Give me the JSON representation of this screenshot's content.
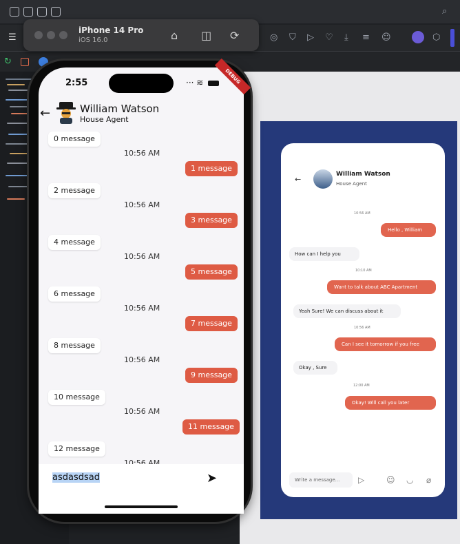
{
  "simulator": {
    "device": "iPhone 14 Pro",
    "os": "iOS 16.0"
  },
  "phone": {
    "time": "2:55",
    "debug_banner": "DEBUG",
    "contact_name": "William Watson",
    "contact_role": "House Agent",
    "messages": [
      {
        "type": "in",
        "text": "0 message"
      },
      {
        "type": "ts",
        "text": "10:56 AM"
      },
      {
        "type": "out",
        "text": "1 message"
      },
      {
        "type": "in",
        "text": "2 message"
      },
      {
        "type": "ts",
        "text": "10:56 AM"
      },
      {
        "type": "out",
        "text": "3 message"
      },
      {
        "type": "in",
        "text": "4 message"
      },
      {
        "type": "ts",
        "text": "10:56 AM"
      },
      {
        "type": "out",
        "text": "5 message"
      },
      {
        "type": "in",
        "text": "6 message"
      },
      {
        "type": "ts",
        "text": "10:56 AM"
      },
      {
        "type": "out",
        "text": "7 message"
      },
      {
        "type": "in",
        "text": "8 message"
      },
      {
        "type": "ts",
        "text": "10:56 AM"
      },
      {
        "type": "out",
        "text": "9 message"
      },
      {
        "type": "in",
        "text": "10 message"
      },
      {
        "type": "ts",
        "text": "10:56 AM"
      },
      {
        "type": "out",
        "text": "11 message"
      },
      {
        "type": "in",
        "text": "12 message"
      },
      {
        "type": "ts",
        "text": "10:56 AM"
      }
    ],
    "input_value": "asdasdsad"
  },
  "preview": {
    "contact_name": "William Watson",
    "contact_role": "House Agent",
    "messages": [
      {
        "type": "ts",
        "text": "10:56 AM"
      },
      {
        "type": "out",
        "text": "Hello , William"
      },
      {
        "type": "in",
        "text": "How can I help you"
      },
      {
        "type": "ts",
        "text": "10:10 AM"
      },
      {
        "type": "out",
        "text": "Want to talk about ABC Apartment"
      },
      {
        "type": "in",
        "text": "Yeah Sure! We can discuss about it"
      },
      {
        "type": "ts",
        "text": "10:56 AM"
      },
      {
        "type": "out",
        "text": "Can I see it tomorrow if you free"
      },
      {
        "type": "in",
        "text": "Okay , Sure"
      },
      {
        "type": "ts",
        "text": "12:00 AM"
      },
      {
        "type": "out",
        "text": "Okay! Will call you later"
      }
    ],
    "input_placeholder": "Write a message..."
  },
  "colors": {
    "outgoing_bubble": "#de5b44",
    "preview_background": "#25397a"
  }
}
